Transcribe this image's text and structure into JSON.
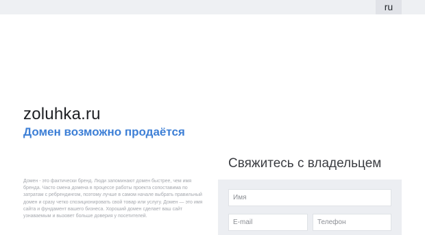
{
  "header": {
    "lang": "ru"
  },
  "hero": {
    "domain": "zoluhka.ru",
    "subtitle": "Домен возможно продаётся",
    "description": "Домен - это фактически бренд. Люди запоминают домен быстрее, чем имя бренда. Часто смена домена в процессе работы проекта сопоставима по затратам с ребрендингом, поэтому лучше в самом начале выбрать правильный домен и сразу четко спозиционировать свой товар или услугу. Домен — это имя сайта и фундамент вашего бизнеса. Хороший домен сделает ваш сайт узнаваемым и вызовет больше доверия у посетителей."
  },
  "contact": {
    "title": "Свяжитесь с владельцем",
    "name_placeholder": "Имя",
    "email_placeholder": "E-mail",
    "phone_placeholder": "Телефон"
  }
}
